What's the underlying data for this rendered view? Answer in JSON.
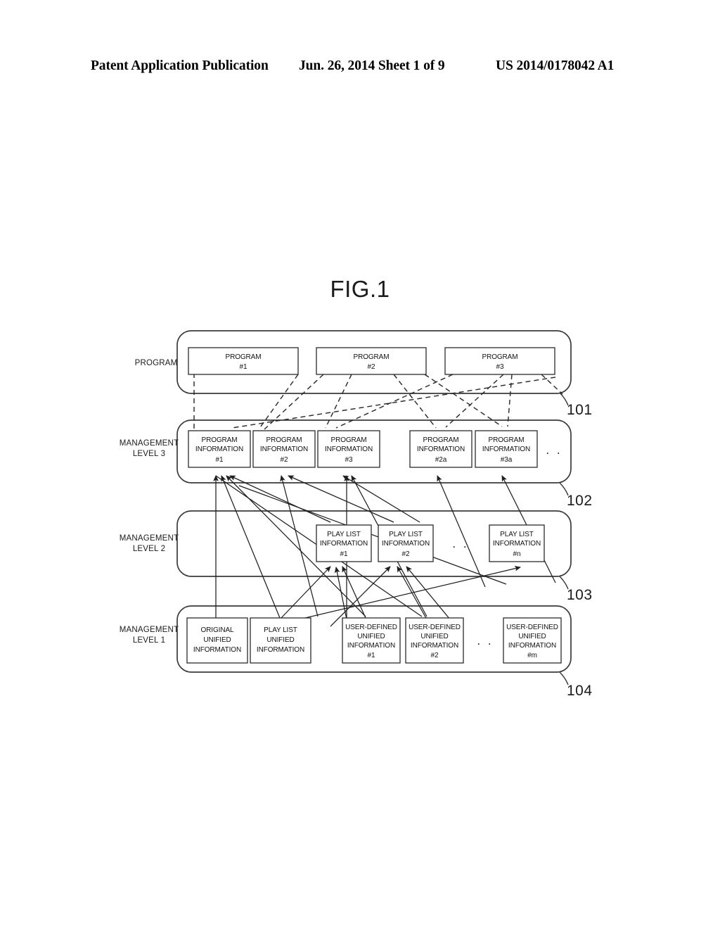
{
  "header": {
    "publication": "Patent Application Publication",
    "date_sheet": "Jun. 26, 2014  Sheet 1 of 9",
    "patent_number": "US 2014/0178042 A1"
  },
  "figure": {
    "title": "FIG.1"
  },
  "row_labels": {
    "program": "PROGRAM",
    "level3_line1": "MANAGEMENT",
    "level3_line2": "LEVEL 3",
    "level2_line1": "MANAGEMENT",
    "level2_line2": "LEVEL 2",
    "level1_line1": "MANAGEMENT",
    "level1_line2": "LEVEL 1"
  },
  "reference_numerals": {
    "program_group": "101",
    "level3_group": "102",
    "level2_group": "103",
    "level1_group": "104"
  },
  "ellipsis_glyph": ". .",
  "program_row": {
    "boxes": [
      {
        "line1": "PROGRAM",
        "line2": "#1"
      },
      {
        "line1": "PROGRAM",
        "line2": "#2"
      },
      {
        "line1": "PROGRAM",
        "line2": "#3"
      }
    ]
  },
  "level3_row": {
    "boxes": [
      {
        "line1": "PROGRAM",
        "line2": "INFORMATION",
        "line3": "#1"
      },
      {
        "line1": "PROGRAM",
        "line2": "INFORMATION",
        "line3": "#2"
      },
      {
        "line1": "PROGRAM",
        "line2": "INFORMATION",
        "line3": "#3"
      },
      {
        "line1": "PROGRAM",
        "line2": "INFORMATION",
        "line3": "#2a"
      },
      {
        "line1": "PROGRAM",
        "line2": "INFORMATION",
        "line3": "#3a"
      }
    ],
    "has_ellipsis": true
  },
  "level2_row": {
    "boxes": [
      {
        "line1": "PLAY LIST",
        "line2": "INFORMATION",
        "line3": "#1"
      },
      {
        "line1": "PLAY LIST",
        "line2": "INFORMATION",
        "line3": "#2"
      },
      {
        "line1": "PLAY LIST",
        "line2": "INFORMATION",
        "line3": "#n"
      }
    ],
    "has_ellipsis": true
  },
  "level1_row": {
    "boxes": [
      {
        "line1": "ORIGINAL",
        "line2": "UNIFIED",
        "line3": "INFORMATION",
        "line4": ""
      },
      {
        "line1": "PLAY LIST",
        "line2": "UNIFIED",
        "line3": "INFORMATION",
        "line4": ""
      },
      {
        "line1": "USER-DEFINED",
        "line2": "UNIFIED",
        "line3": "INFORMATION",
        "line4": "#1"
      },
      {
        "line1": "USER-DEFINED",
        "line2": "UNIFIED",
        "line3": "INFORMATION",
        "line4": "#2"
      },
      {
        "line1": "USER-DEFINED",
        "line2": "UNIFIED",
        "line3": "INFORMATION",
        "line4": "#m"
      }
    ],
    "has_ellipsis": true
  },
  "colors": {
    "ink": "#1a1a1a",
    "box_stroke": "#2b2b2b",
    "group_stroke": "#3a3a3a",
    "paper": "#ffffff"
  }
}
